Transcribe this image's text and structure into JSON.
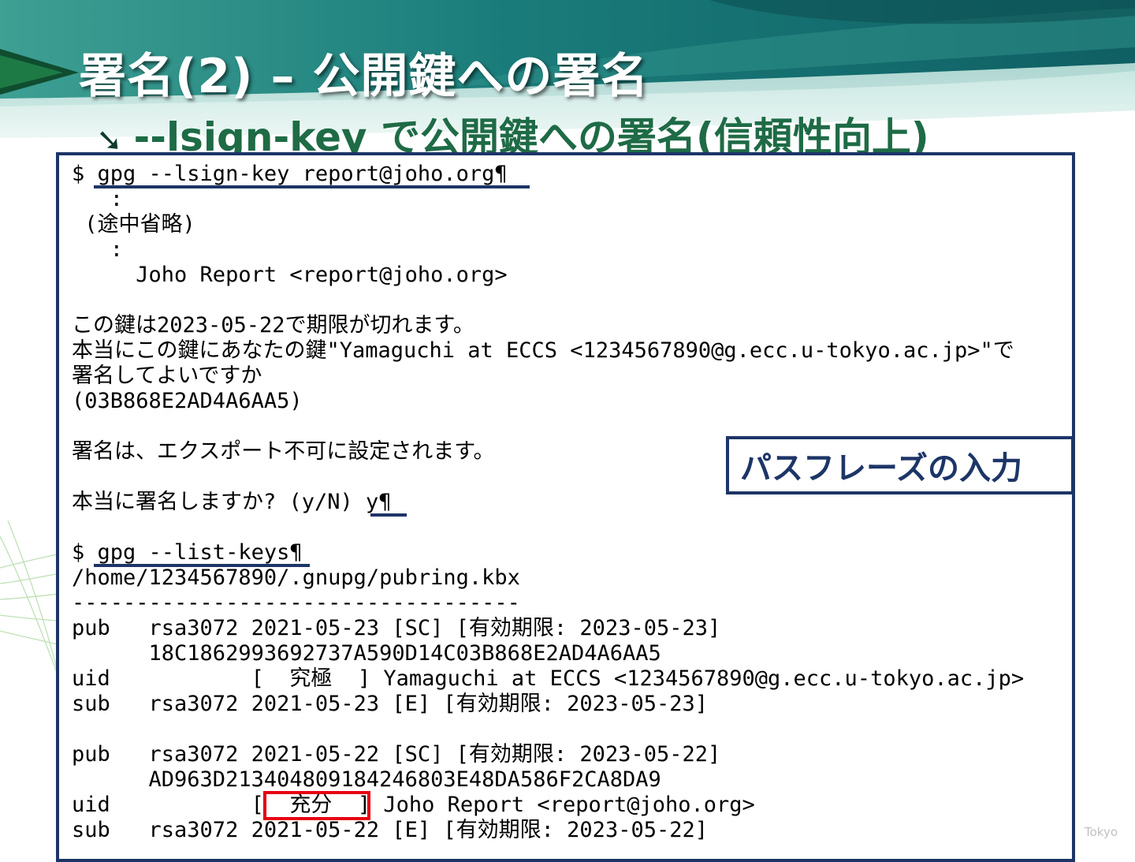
{
  "slide": {
    "title": "署名(2) – 公開鍵への署名",
    "subtitle_arrow": "➘",
    "subtitle": "--lsign-key で公開鍵への署名(信頼性向上)",
    "footer": "Tokyo"
  },
  "terminal": {
    "lines": [
      "$ gpg --lsign-key report@joho.org¶",
      "   :",
      " (途中省略)",
      "   :",
      "     Joho Report <report@joho.org>",
      "",
      "この鍵は2023-05-22で期限が切れます。",
      "本当にこの鍵にあなたの鍵\"Yamaguchi at ECCS <1234567890@g.ecc.u-tokyo.ac.jp>\"で",
      "署名してよいですか",
      "(03B868E2AD4A6AA5)",
      "",
      "署名は、エクスポート不可に設定されます。",
      "",
      "本当に署名しますか? (y/N) y¶",
      "",
      "$ gpg --list-keys¶",
      "/home/1234567890/.gnupg/pubring.kbx",
      "-----------------------------------",
      "pub   rsa3072 2021-05-23 [SC] [有効期限: 2023-05-23]",
      "      18C1862993692737A590D14C03B868E2AD4A6AA5",
      "uid           [  究極  ] Yamaguchi at ECCS <1234567890@g.ecc.u-tokyo.ac.jp>",
      "sub   rsa3072 2021-05-23 [E] [有効期限: 2023-05-23]",
      "",
      "pub   rsa3072 2021-05-22 [SC] [有効期限: 2023-05-22]",
      "      AD963D213404809184246803E48DA586F2CA8DA9",
      "uid           [  充分  ] Joho Report <report@joho.org>",
      "sub   rsa3072 2021-05-22 [E] [有効期限: 2023-05-22]"
    ]
  },
  "callout": {
    "label": "パスフレーズの入力"
  },
  "colors": {
    "frame": "#1d3567",
    "highlight": "#e60012",
    "title_text": "#ffffff",
    "subtitle_text": "#1e6b46",
    "banner": "#16706c"
  }
}
